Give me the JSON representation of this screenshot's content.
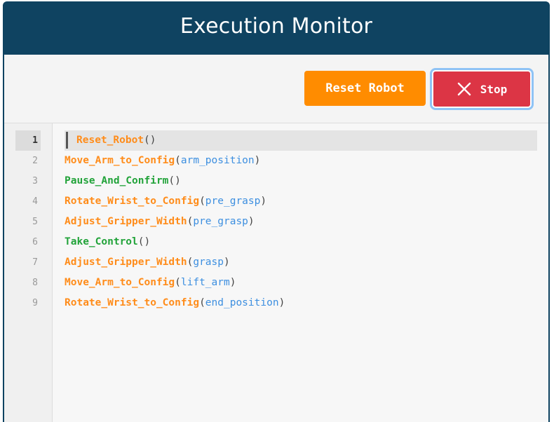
{
  "header": {
    "title": "Execution Monitor"
  },
  "toolbar": {
    "reset_label": "Reset Robot",
    "stop_label": "Stop",
    "stop_icon": "close-icon"
  },
  "colors": {
    "header_bg": "#0f4361",
    "reset_button": "#ff8c00",
    "stop_button": "#dc3545",
    "function_orange": "#ff8c1a",
    "function_green": "#22a33a",
    "parameter_blue": "#3d8fe0"
  },
  "editor": {
    "active_line": 1,
    "lines": [
      {
        "number": "1",
        "func": "Reset_Robot",
        "open": "(",
        "param": "",
        "close": ")",
        "color": "orange"
      },
      {
        "number": "2",
        "func": "Move_Arm_to_Config",
        "open": "(",
        "param": "arm_position",
        "close": ")",
        "color": "orange"
      },
      {
        "number": "3",
        "func": "Pause_And_Confirm",
        "open": "(",
        "param": "",
        "close": ")",
        "color": "green"
      },
      {
        "number": "4",
        "func": "Rotate_Wrist_to_Config",
        "open": "(",
        "param": "pre_grasp",
        "close": ")",
        "color": "orange"
      },
      {
        "number": "5",
        "func": "Adjust_Gripper_Width",
        "open": "(",
        "param": "pre_grasp",
        "close": ")",
        "color": "orange"
      },
      {
        "number": "6",
        "func": "Take_Control",
        "open": "(",
        "param": "",
        "close": ")",
        "color": "green"
      },
      {
        "number": "7",
        "func": "Adjust_Gripper_Width",
        "open": "(",
        "param": "grasp",
        "close": ")",
        "color": "orange"
      },
      {
        "number": "8",
        "func": "Move_Arm_to_Config",
        "open": "(",
        "param": "lift_arm",
        "close": ")",
        "color": "orange"
      },
      {
        "number": "9",
        "func": "Rotate_Wrist_to_Config",
        "open": "(",
        "param": "end_position",
        "close": ")",
        "color": "orange"
      }
    ]
  }
}
